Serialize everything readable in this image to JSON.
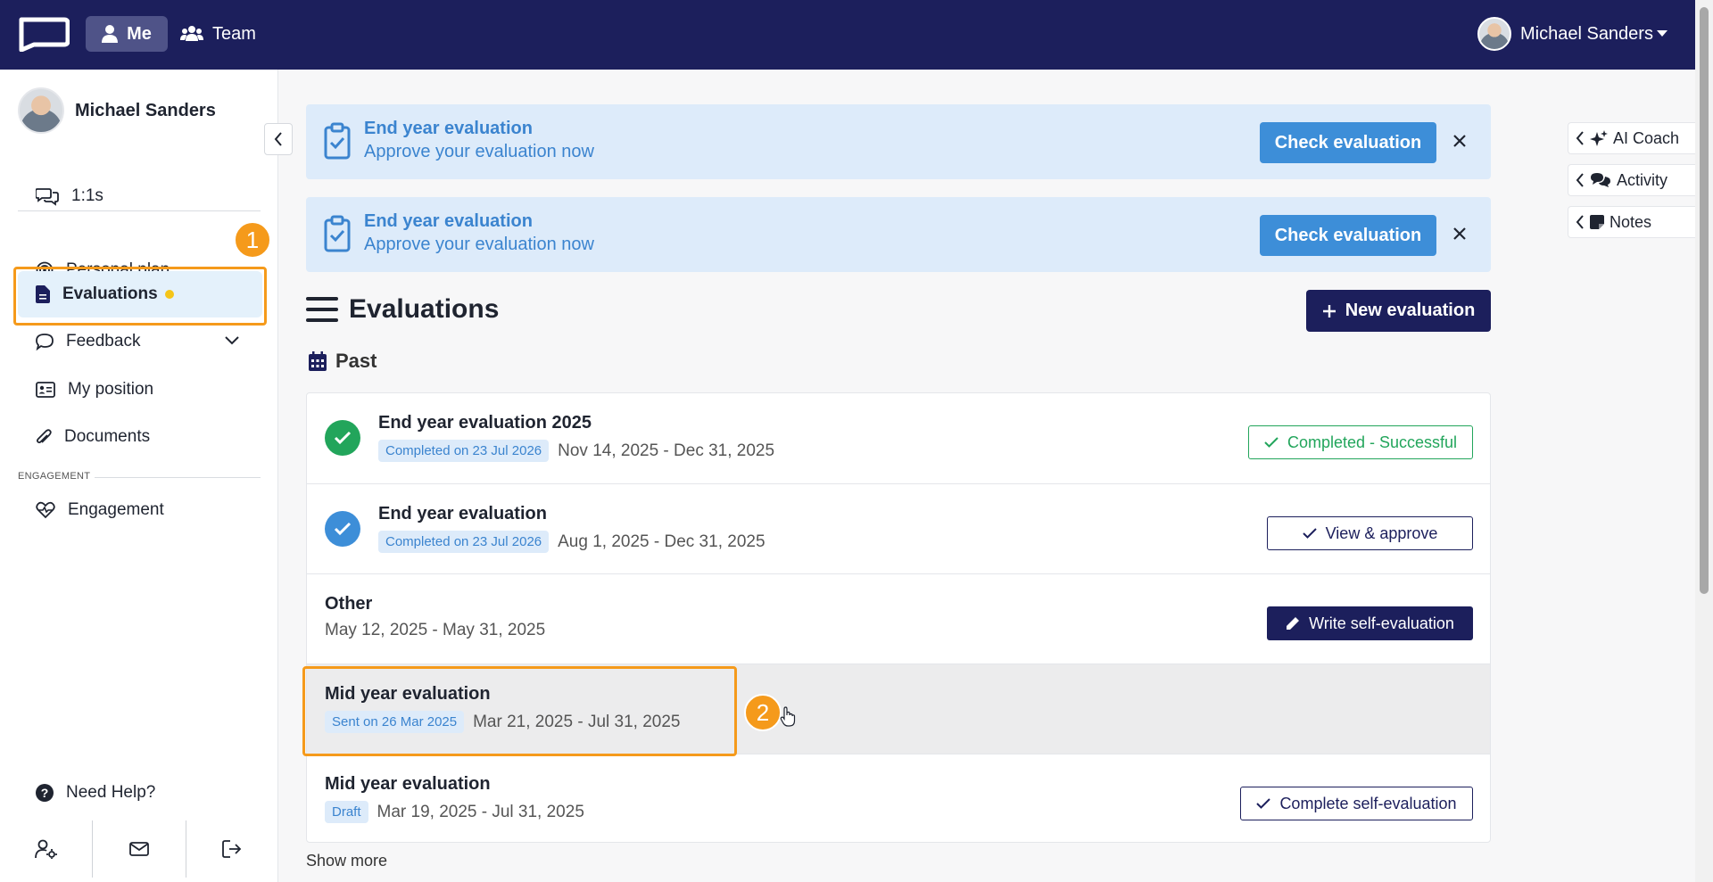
{
  "topbar": {
    "nav_me": "Me",
    "nav_team": "Team",
    "user_name": "Michael Sanders"
  },
  "sidebar": {
    "profile_name": "Michael Sanders",
    "one_on_ones": "1:1s",
    "items": [
      {
        "label": "Personal plan"
      },
      {
        "label": "Evaluations"
      },
      {
        "label": "Feedback"
      },
      {
        "label": "My position"
      },
      {
        "label": "Documents"
      }
    ],
    "section_engagement": "ENGAGEMENT",
    "engagement": "Engagement",
    "need_help": "Need Help?"
  },
  "annotations": {
    "badge1": "1",
    "badge2": "2"
  },
  "banners": [
    {
      "title": "End year evaluation",
      "subtitle": "Approve your evaluation now",
      "button": "Check evaluation"
    },
    {
      "title": "End year evaluation",
      "subtitle": "Approve your evaluation now",
      "button": "Check evaluation"
    }
  ],
  "main": {
    "title": "Evaluations",
    "new_button": "New evaluation",
    "section": "Past",
    "show_more": "Show more"
  },
  "evaluations": [
    {
      "title": "End year evaluation 2025",
      "chip": "Completed on 23 Jul 2026",
      "dates": "Nov 14, 2025 - Dec 31, 2025",
      "action": "Completed - Successful"
    },
    {
      "title": "End year evaluation",
      "chip": "Completed on 23 Jul 2026",
      "dates": "Aug 1, 2025 - Dec 31, 2025",
      "action": "View & approve"
    },
    {
      "title": "Other",
      "dates": "May 12, 2025 - May 31, 2025",
      "action": "Write self-evaluation"
    },
    {
      "title": "Mid year evaluation",
      "chip": "Sent on 26 Mar 2025",
      "dates": "Mar 21, 2025 - Jul 31, 2025"
    },
    {
      "title": "Mid year evaluation",
      "chip": "Draft",
      "dates": "Mar 19, 2025 - Jul 31, 2025",
      "action": "Complete self-evaluation"
    }
  ],
  "rail": {
    "ai_coach": "AI Coach",
    "activity": "Activity",
    "notes": "Notes"
  },
  "colors": {
    "navy": "#1c1f5c",
    "accent_blue": "#3d8ed8",
    "success_green": "#22a55b",
    "highlight_orange": "#f59a1b"
  }
}
